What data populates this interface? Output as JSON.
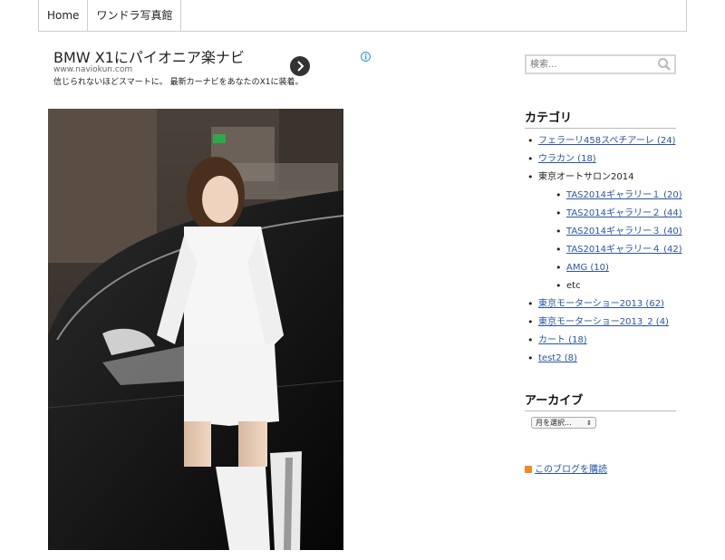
{
  "nav": {
    "items": [
      {
        "label": "Home"
      },
      {
        "label": "ワンドラ写真館"
      }
    ]
  },
  "ad": {
    "title": "BMW X1にパイオニア楽ナビ",
    "url": "www.naviokun.com",
    "description": "信じられないほどスマートに。 最新カーナビをあなたのX1に装着。",
    "info_icon": "info-icon",
    "arrow_icon": "chevron-right-icon"
  },
  "search": {
    "placeholder": "検索...",
    "icon": "search-icon"
  },
  "categories": {
    "title": "カテゴリ",
    "items": [
      {
        "label": "フェラーリ458スペチアーレ (24)"
      },
      {
        "label": "ウラカン (18)"
      },
      {
        "label": "東京オートサロン2014",
        "children": [
          {
            "label": "TAS2014ギャラリー１ (20)"
          },
          {
            "label": "TAS2014ギャラリー２ (44)"
          },
          {
            "label": "TAS2014ギャラリー３ (40)"
          },
          {
            "label": "TAS2014ギャラリー４ (42)"
          },
          {
            "label": "AMG (10)"
          },
          {
            "label": "etc"
          }
        ]
      },
      {
        "label": "東京モーターショー2013 (62)"
      },
      {
        "label": "東京モーターショー2013_2 (4)"
      },
      {
        "label": "カート (18)"
      },
      {
        "label": "test2 (8)"
      }
    ]
  },
  "archive": {
    "title": "アーカイブ",
    "select_value": "月を選択..."
  },
  "subscribe": {
    "label": "このブログを購読",
    "icon": "rss-icon"
  },
  "colors": {
    "link": "#2a55a6",
    "rss": "#f08a24",
    "photo_bg": "#1a1a1a"
  }
}
